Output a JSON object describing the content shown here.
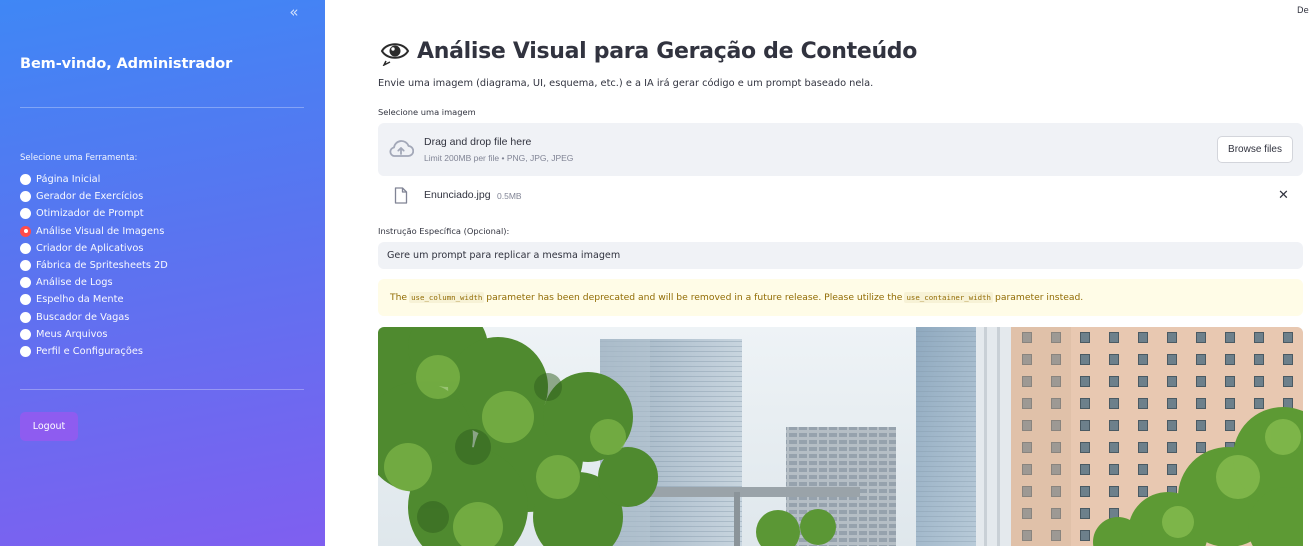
{
  "sidebar": {
    "collapse_glyph": "«",
    "welcome": "Bem-vindo, Administrador",
    "tool_label": "Selecione uma Ferramenta:",
    "items": [
      {
        "label": "Página Inicial",
        "selected": false
      },
      {
        "label": "Gerador de Exercícios",
        "selected": false
      },
      {
        "label": "Otimizador de Prompt",
        "selected": false
      },
      {
        "label": "Análise Visual de Imagens",
        "selected": true
      },
      {
        "label": "Criador de Aplicativos",
        "selected": false
      },
      {
        "label": "Fábrica de Spritesheets 2D",
        "selected": false
      },
      {
        "label": "Análise de Logs",
        "selected": false
      },
      {
        "label": "Espelho da Mente",
        "selected": false
      },
      {
        "label": "Buscador de Vagas",
        "selected": false
      },
      {
        "label": "Meus Arquivos",
        "selected": false
      },
      {
        "label": "Perfil e Configurações",
        "selected": false
      }
    ],
    "logout_label": "Logout"
  },
  "header": {
    "corner_text": "De"
  },
  "main": {
    "title": "Análise Visual para Geração de Conteúdo",
    "title_icon": "eye-icon",
    "subtitle": "Envie uma imagem (diagrama, UI, esquema, etc.) e a IA irá gerar código e um prompt baseado nela.",
    "uploader": {
      "label": "Selecione uma imagem",
      "drag_text": "Drag and drop file here",
      "limit_text": "Limit 200MB per file • PNG, JPG, JPEG",
      "browse_label": "Browse files",
      "icon": "cloud-upload-icon"
    },
    "file": {
      "name": "Enunciado.jpg",
      "size": "0.5MB",
      "icon": "file-icon",
      "close_glyph": "✕"
    },
    "instruction": {
      "label": "Instrução Específica (Opcional):",
      "value": "Gere um prompt para replicar a mesma imagem"
    },
    "warning": {
      "prefix": "The",
      "code1": "use_column_width",
      "middle": "parameter has been deprecated and will be removed in a future release. Please utilize the",
      "code2": "use_container_width",
      "suffix": "parameter instead."
    },
    "image": {
      "subject": "city-trees-skyscrapers-photo"
    }
  },
  "colors": {
    "sidebar_gradient_start": "#3f87f5",
    "sidebar_gradient_end": "#7f5ff0",
    "radio_selected": "#ff4b4b",
    "logout_bg": "#8e5cf0",
    "warning_bg": "#fffce7",
    "warning_text": "#926c05",
    "input_bg": "#f0f2f6"
  }
}
